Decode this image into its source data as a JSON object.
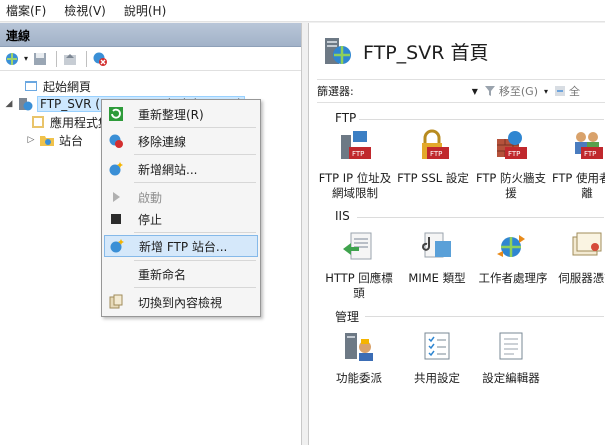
{
  "menubar": {
    "items": [
      "檔案(F)",
      "檢視(V)",
      "說明(H)"
    ]
  },
  "connections": {
    "header": "連線",
    "tree": {
      "start_page": "起始網頁",
      "server": "FTP_SVR (FTP_SVR\\Administrator)",
      "app_pools": "應用程式集區",
      "sites": "站台"
    }
  },
  "context_menu": {
    "items": [
      {
        "label": "重新整理(R)",
        "icon": "refresh-icon",
        "disabled": false
      },
      {
        "label": "移除連線",
        "icon": "remove-connection-icon",
        "disabled": false
      },
      {
        "label": "新增網站...",
        "icon": "add-website-icon",
        "disabled": false
      },
      {
        "label": "啟動",
        "icon": "start-icon",
        "disabled": true
      },
      {
        "label": "停止",
        "icon": "stop-icon",
        "disabled": false
      },
      {
        "label": "新增 FTP 站台...",
        "icon": "add-ftp-site-icon",
        "disabled": false,
        "highlighted": true
      },
      {
        "label": "重新命名",
        "icon": "",
        "disabled": false
      },
      {
        "label": "切換到內容檢視",
        "icon": "content-view-icon",
        "disabled": false
      }
    ]
  },
  "main": {
    "title": "FTP_SVR 首頁",
    "filter": {
      "label": "篩選器:",
      "go_label": "移至(G)",
      "show_all_label": "全"
    },
    "sections": [
      {
        "name": "FTP",
        "features": [
          {
            "label": "FTP IP 位址及網域限制",
            "icon": "ftp-ip-restrictions-icon"
          },
          {
            "label": "FTP SSL 設定",
            "icon": "ftp-ssl-icon"
          },
          {
            "label": "FTP 防火牆支援",
            "icon": "ftp-firewall-icon"
          },
          {
            "label": "FTP 使用者隔離",
            "icon": "ftp-user-isolation-icon"
          }
        ]
      },
      {
        "name": "IIS",
        "features": [
          {
            "label": "HTTP 回應標頭",
            "icon": "http-headers-icon"
          },
          {
            "label": "MIME 類型",
            "icon": "mime-types-icon"
          },
          {
            "label": "工作者處理序",
            "icon": "worker-process-icon"
          },
          {
            "label": "伺服器憑證",
            "icon": "server-certificates-icon"
          }
        ]
      },
      {
        "name": "管理",
        "features": [
          {
            "label": "功能委派",
            "icon": "feature-delegation-icon"
          },
          {
            "label": "共用設定",
            "icon": "shared-config-icon"
          },
          {
            "label": "設定編輯器",
            "icon": "config-editor-icon"
          }
        ]
      }
    ]
  },
  "colors": {
    "highlight": "#d5e8fa",
    "header": "#a2b2c8",
    "ftp_red": "#c0282d"
  }
}
